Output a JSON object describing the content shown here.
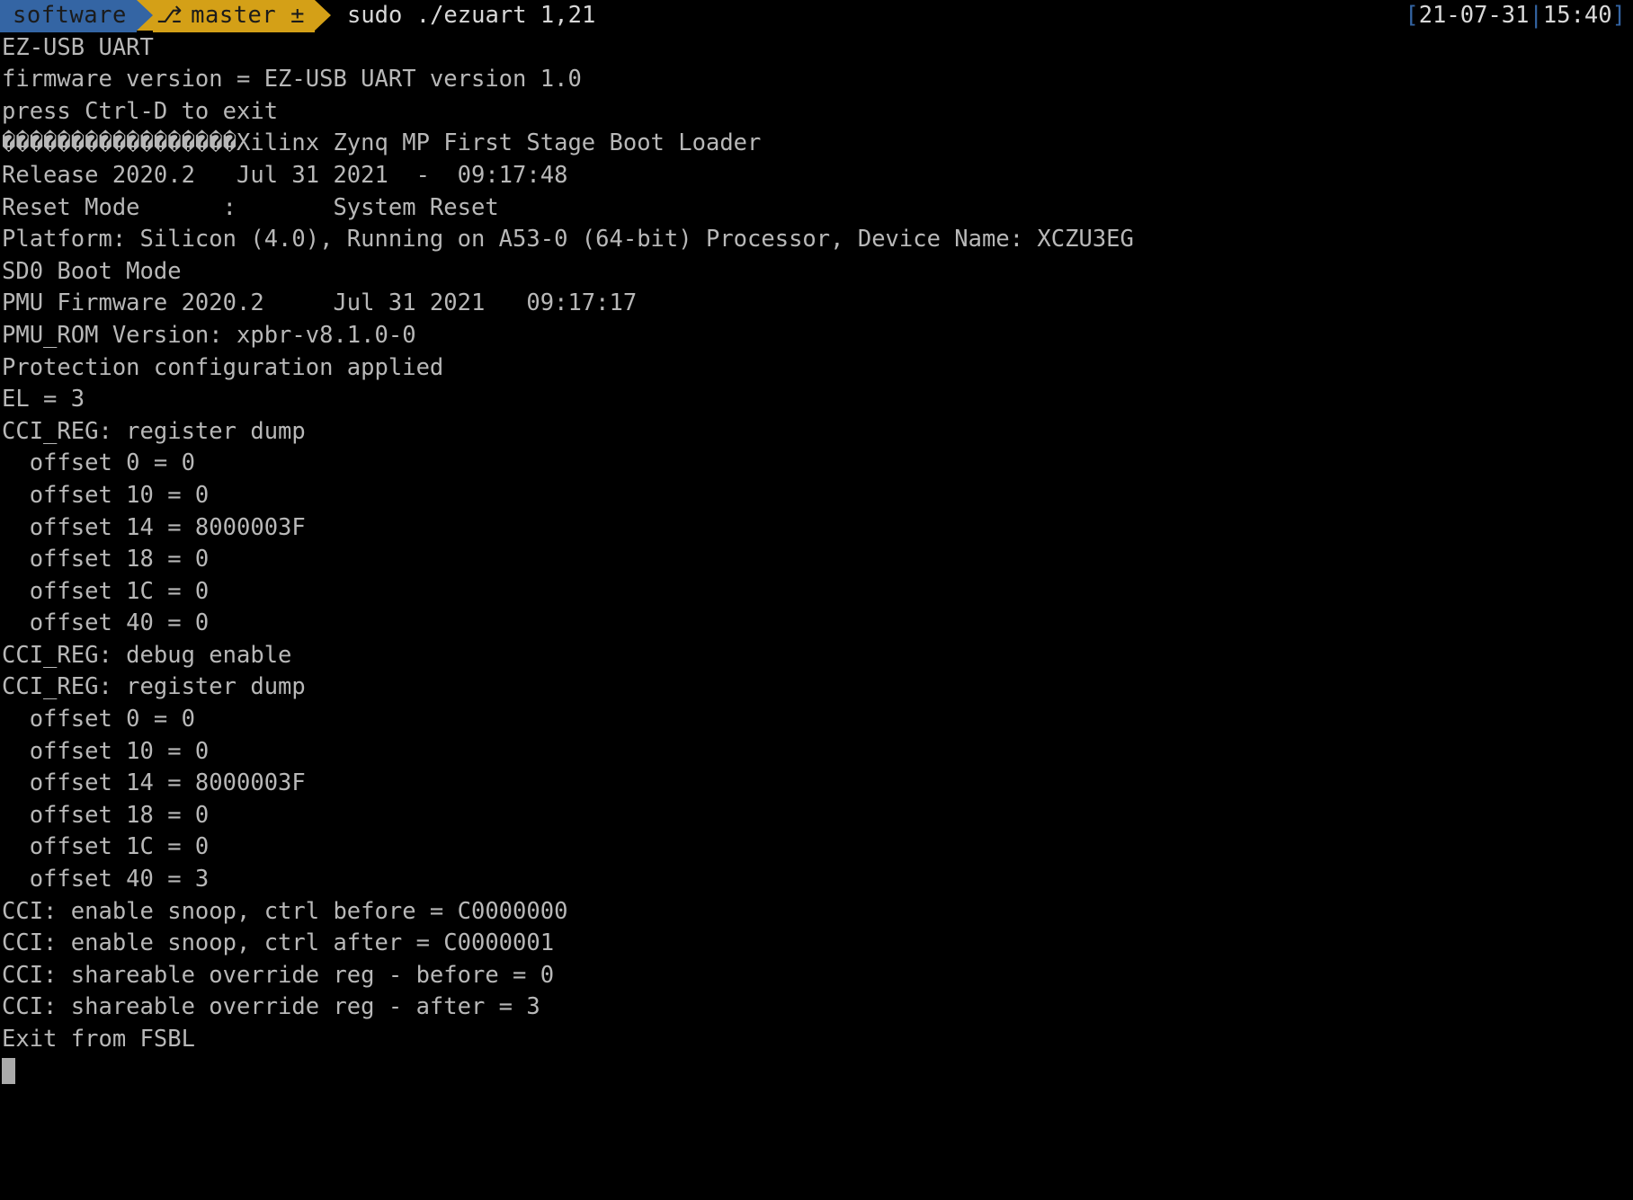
{
  "window": {
    "title": "Terminal",
    "background_color": "#000000",
    "foreground_color": "#b8b8b8"
  },
  "prompt": {
    "directory_segment": {
      "label": "software",
      "background_color": "#3465a4",
      "text_color": "#1b1b1b"
    },
    "git_segment": {
      "branch_icon": "git-branch-icon",
      "branch_glyph": "⎇",
      "label": "master ±",
      "background_color": "#d4a017",
      "text_color": "#1b1b1b"
    },
    "command": "sudo ./ezuart 1,21",
    "timestamp": {
      "open_bracket": "[",
      "date": "21-07-31",
      "separator": "|",
      "time": "15:40",
      "close_bracket": "]",
      "bracket_color": "#3465a4",
      "text_color": "#d8d8d8"
    }
  },
  "output": {
    "lines": [
      "EZ-USB UART",
      "firmware version = EZ-USB UART version 1.0",
      "press Ctrl-D to exit",
      "�����������������Xilinx Zynq MP First Stage Boot Loader",
      "Release 2020.2   Jul 31 2021  -  09:17:48",
      "Reset Mode      :       System Reset",
      "Platform: Silicon (4.0), Running on A53-0 (64-bit) Processor, Device Name: XCZU3EG",
      "SD0 Boot Mode",
      "PMU Firmware 2020.2     Jul 31 2021   09:17:17",
      "PMU_ROM Version: xpbr-v8.1.0-0",
      "Protection configuration applied",
      "EL = 3",
      "CCI_REG: register dump",
      "  offset 0 = 0",
      "  offset 10 = 0",
      "  offset 14 = 8000003F",
      "  offset 18 = 0",
      "  offset 1C = 0",
      "  offset 40 = 0",
      "CCI_REG: debug enable",
      "CCI_REG: register dump",
      "  offset 0 = 0",
      "  offset 10 = 0",
      "  offset 14 = 8000003F",
      "  offset 18 = 0",
      "  offset 1C = 0",
      "  offset 40 = 3",
      "CCI: enable snoop, ctrl before = C0000000",
      "CCI: enable snoop, ctrl after = C0000001",
      "CCI: shareable override reg - before = 0",
      "CCI: shareable override reg - after = 3",
      "Exit from FSBL"
    ]
  },
  "cursor": {
    "shape": "block",
    "color": "#ababab"
  }
}
